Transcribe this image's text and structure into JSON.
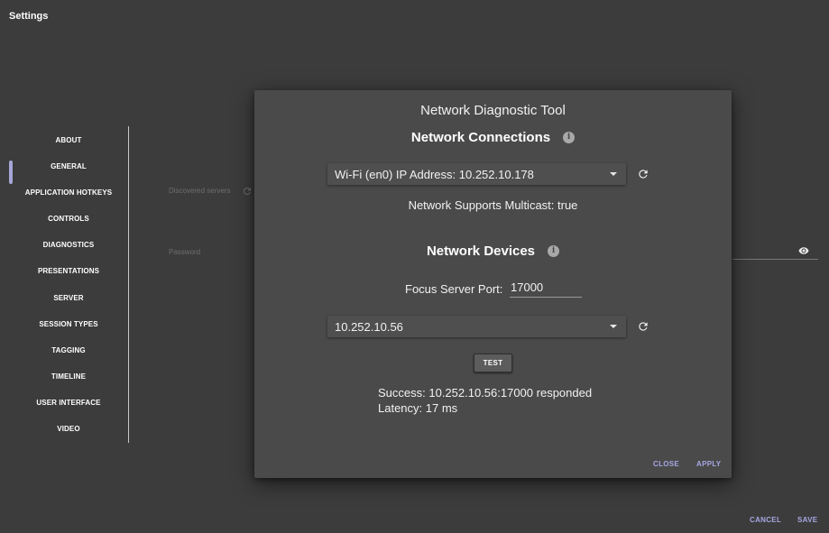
{
  "app": {
    "title": "Settings"
  },
  "sidebar": {
    "items": [
      {
        "label": "ABOUT"
      },
      {
        "label": "GENERAL"
      },
      {
        "label": "APPLICATION HOTKEYS"
      },
      {
        "label": "CONTROLS"
      },
      {
        "label": "DIAGNOSTICS"
      },
      {
        "label": "PRESENTATIONS"
      },
      {
        "label": "SERVER"
      },
      {
        "label": "SESSION TYPES"
      },
      {
        "label": "TAGGING"
      },
      {
        "label": "TIMELINE"
      },
      {
        "label": "USER INTERFACE"
      },
      {
        "label": "VIDEO"
      }
    ],
    "selected_index": 6,
    "accent_color": "#a7a6d8"
  },
  "background_form": {
    "discovered_servers_label": "Discovered servers",
    "password_label": "Password"
  },
  "footer": {
    "cancel_label": "CANCEL",
    "save_label": "SAVE"
  },
  "dialog": {
    "title": "Network Diagnostic Tool",
    "connections": {
      "heading": "Network Connections",
      "selected_interface": "Wi-Fi (en0) IP Address: 10.252.10.178",
      "multicast_status": "Network Supports Multicast: true"
    },
    "devices": {
      "heading": "Network Devices",
      "port_label": "Focus Server Port:",
      "port_value": "17000",
      "selected_device": "10.252.10.56",
      "test_label": "TEST",
      "result_line1": "Success: 10.252.10.56:17000 responded",
      "result_line2": "Latency: 17 ms"
    },
    "close_label": "CLOSE",
    "apply_label": "APPLY"
  },
  "colors": {
    "background": "#3c3c3c",
    "dialog": "#4a4a4a",
    "action_text": "#a7a6e2"
  },
  "icons": [
    "refresh-icon",
    "info-icon",
    "eye-icon",
    "dropdown-caret-icon"
  ]
}
